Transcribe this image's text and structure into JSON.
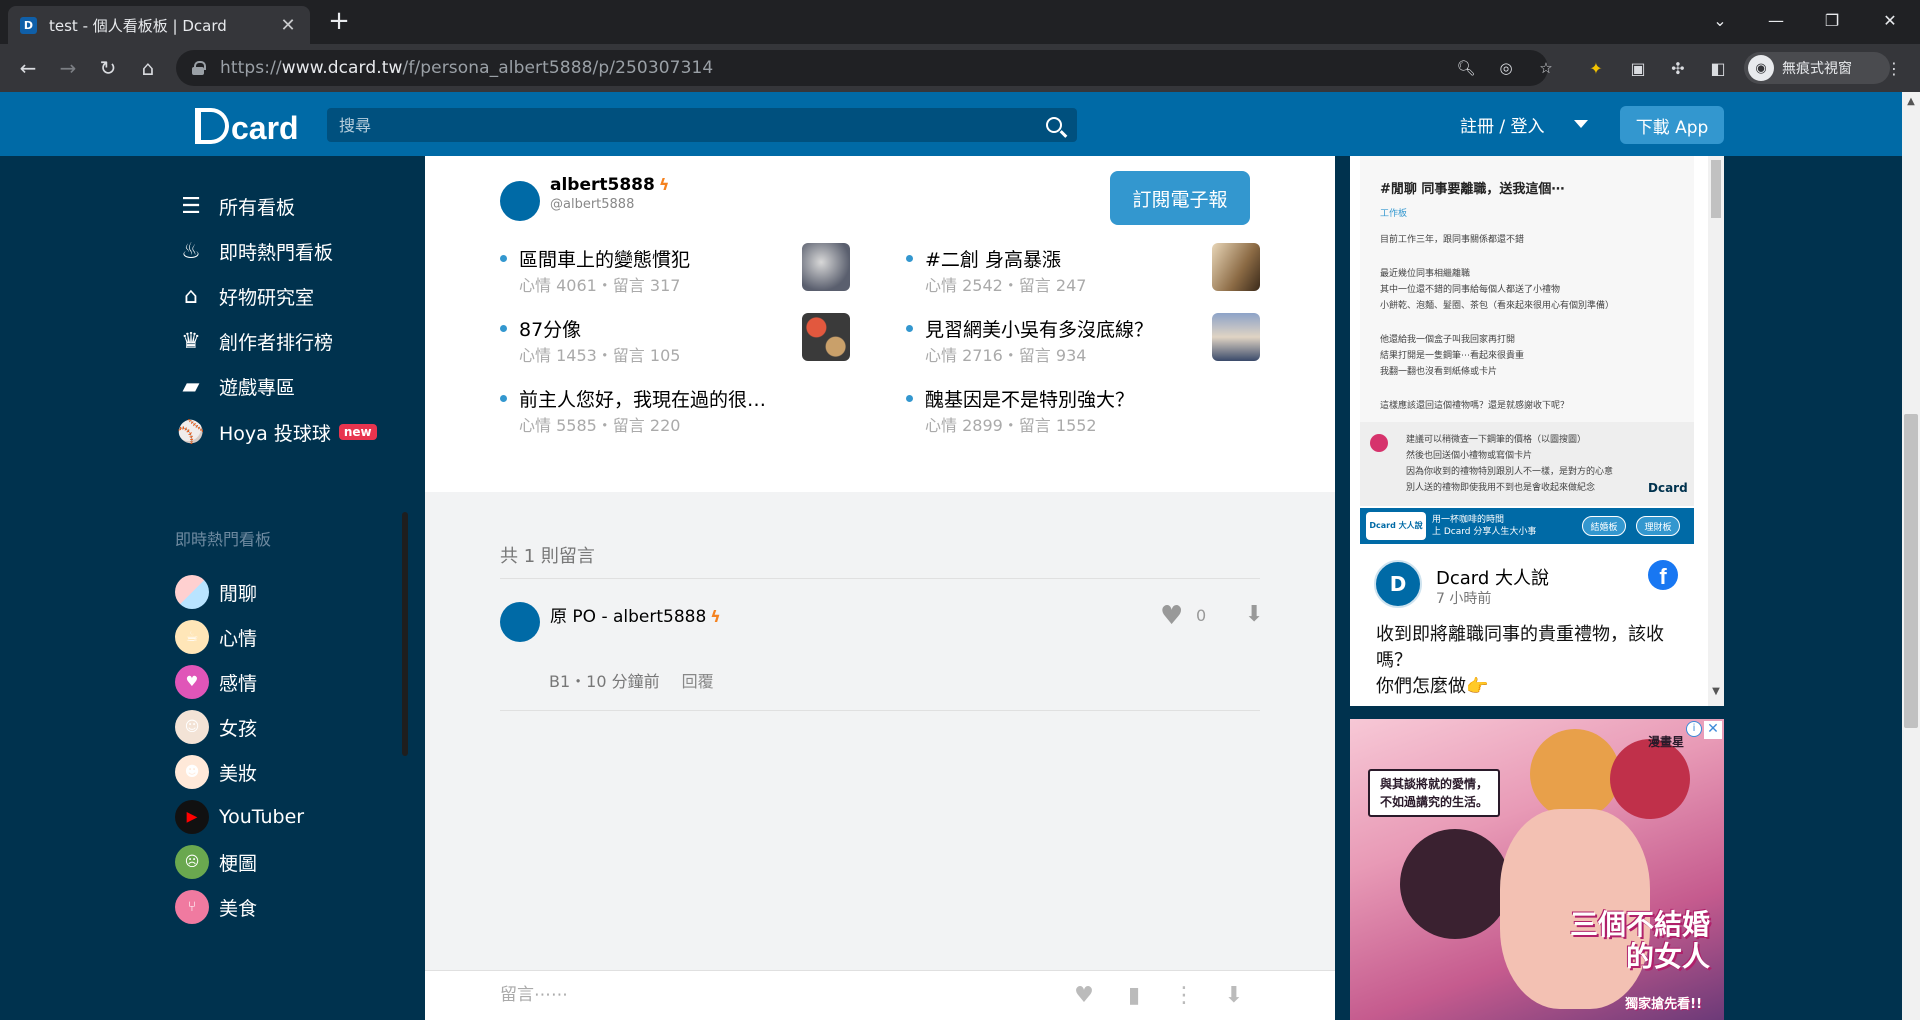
{
  "browser": {
    "tab_title": "test - 個人看板板 | Dcard",
    "tab_favicon": "D",
    "new_tab": "+",
    "url_scheme": "https://",
    "url_host": "www.dcard.tw",
    "url_path": "/f/persona_albert5888/p/250307314",
    "profile_label": "無痕式視窗",
    "icons": [
      "back-arrow-icon",
      "forward-arrow-icon",
      "reload-icon",
      "home-icon",
      "zoom-icon",
      "eye-off-icon",
      "star-icon",
      "extension-icon",
      "puzzle-icon",
      "sidepanel-icon",
      "incognito-icon",
      "more-icon"
    ]
  },
  "header": {
    "logo_text": "card",
    "search_placeholder": "搜尋",
    "login": "註冊 / 登入",
    "download": "下載 App",
    "colors": {
      "brand": "#006aa6",
      "accent": "#3397cf",
      "dark": "#00324e"
    }
  },
  "sidebar": {
    "main_items": [
      {
        "label": "所有看板",
        "icon": "list-icon"
      },
      {
        "label": "即時熱門看板",
        "icon": "fire-icon"
      },
      {
        "label": "好物研究室",
        "icon": "store-icon"
      },
      {
        "label": "創作者排行榜",
        "icon": "trophy-icon"
      },
      {
        "label": "遊戲專區",
        "icon": "gamepad-icon"
      },
      {
        "label": "Hoya 投球球",
        "icon": "baseball-icon",
        "badge": "new"
      }
    ],
    "section_title": "即時熱門看板",
    "boards": [
      {
        "label": "閒聊"
      },
      {
        "label": "心情"
      },
      {
        "label": "感情"
      },
      {
        "label": "女孩"
      },
      {
        "label": "美妝"
      },
      {
        "label": "YouTuber"
      },
      {
        "label": "梗圖"
      },
      {
        "label": "美食"
      }
    ]
  },
  "author": {
    "name": "albert5888",
    "handle": "@albert5888",
    "subscribe": "訂閱電子報",
    "bolt": "ϟ"
  },
  "related_posts": [
    {
      "title": "區間車上的變態慣犯",
      "meta": "心情 4061・留言 317",
      "thumb": true
    },
    {
      "title": "#二創 身高暴漲",
      "meta": "心情 2542・留言 247",
      "thumb": true
    },
    {
      "title": "87分像",
      "meta": "心情 1453・留言 105",
      "thumb": true
    },
    {
      "title": "見習網美小吳有多沒底線？",
      "meta": "心情 2716・留言 934",
      "thumb": true
    },
    {
      "title": "前主人您好，我現在過的很…",
      "meta": "心情 5585・留言 220",
      "thumb": false
    },
    {
      "title": "醜基因是不是特別強大？",
      "meta": "心情 2899・留言 1552",
      "thumb": false
    }
  ],
  "comments": {
    "count_label": "共 1 則留言",
    "items": [
      {
        "author": "原 PO - albert5888",
        "likes": "0",
        "floor_time": "B1・10 分鐘前",
        "reply": "回覆"
      }
    ]
  },
  "comment_bar": {
    "placeholder": "留言⋯⋯"
  },
  "fb_embed": {
    "image_title": "#閒聊 同事要離職，送我這個⋯",
    "image_tag": "工作板",
    "image_lines": [
      "目前工作三年，跟同事關係都還不錯",
      "最近幾位同事相繼離職",
      "其中一位還不錯的同事給每個人都送了小禮物",
      "小餅乾、泡麵、髮圈、茶包（看來起來很用心有個別準備）",
      "他還給我一個盒子叫我回家再打開",
      "結果打開是一隻鋼筆⋯看起來很貴重",
      "我翻一翻也沒看到紙條或卡片",
      "這樣應該還回這個禮物嗎？還是就感謝收下呢？"
    ],
    "reply_lines": [
      "建議可以稍微查一下鋼筆的價格（以圖搜圖）",
      "然後也回送個小禮物或寫個卡片",
      "因為你收到的禮物特別跟別人不一樣，是對方的心意",
      "別人送的禮物即使我用不到也是會收起來做紀念"
    ],
    "image_dcard_mark": "Dcard",
    "banner_logo": "Dcard 大人說",
    "banner_text_1": "用一杯咖啡的時間",
    "banner_text_2": "上 Dcard 分享人生大小事",
    "banner_btn_1": "結婚板",
    "banner_btn_2": "理財板",
    "page_name": "Dcard 大人說",
    "time": "7 小時前",
    "text": "收到即將離職同事的貴重禮物，該收嗎？\n你們怎麼做👉"
  },
  "ad": {
    "brand": "漫畫星",
    "quote_1": "與其談將就的愛情，",
    "quote_2": "不如過講究的生活。",
    "title_1": "三個不結婚",
    "title_2": "的女人",
    "subtitle": "獨家搶先看!!",
    "close": "✕",
    "info": "i"
  }
}
